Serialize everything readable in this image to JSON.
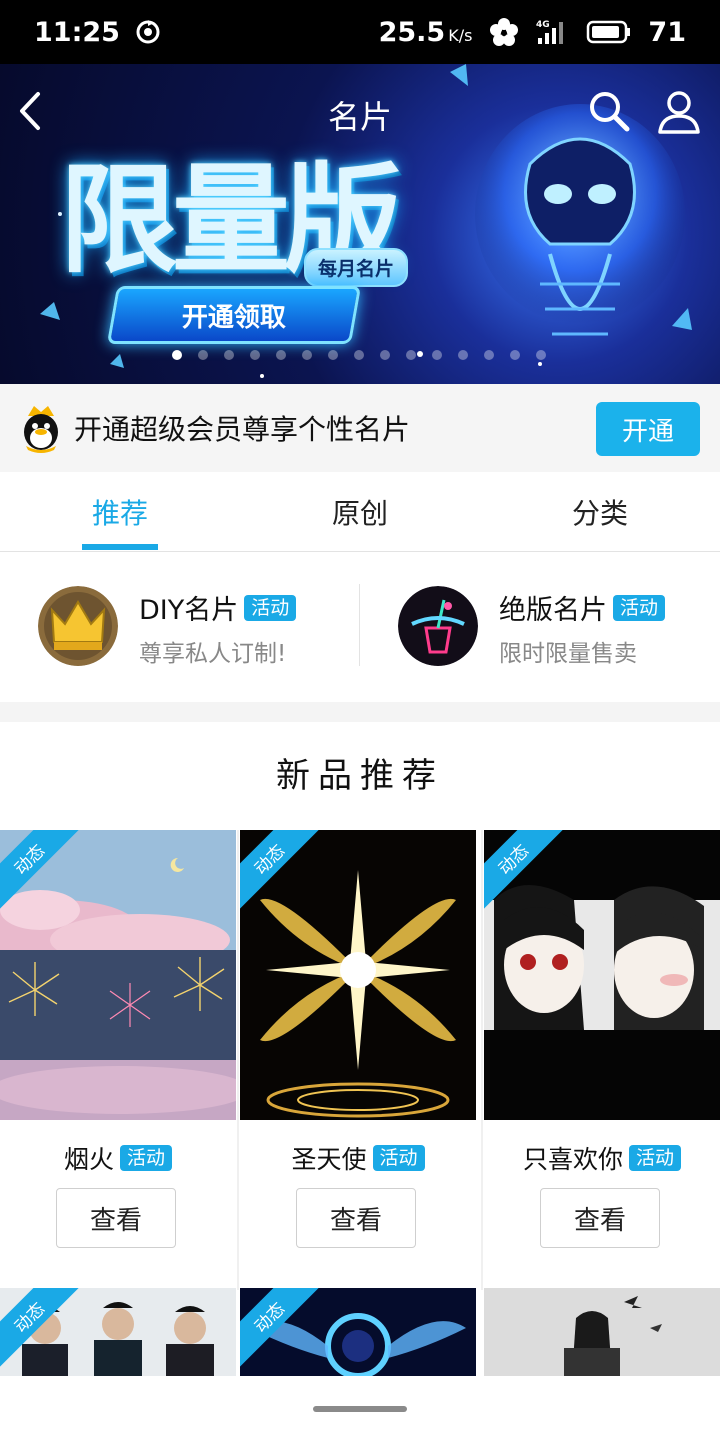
{
  "status_bar": {
    "time": "11:25",
    "net_speed": "25.5",
    "net_speed_unit": "K/s",
    "network": "4G",
    "battery": "71"
  },
  "header": {
    "title": "名片"
  },
  "banner": {
    "headline": "限量版",
    "sub": "每月名片",
    "cta": "开通领取",
    "dots_total": 15,
    "active_dot": 0
  },
  "vip": {
    "text": "开通超级会员尊享个性名片",
    "button": "开通"
  },
  "tabs": [
    {
      "label": "推荐",
      "active": true
    },
    {
      "label": "原创",
      "active": false
    },
    {
      "label": "分类",
      "active": false
    }
  ],
  "features": [
    {
      "title": "DIY名片",
      "tag": "活动",
      "desc": "尊享私人订制!"
    },
    {
      "title": "绝版名片",
      "tag": "活动",
      "desc": "限时限量售卖"
    }
  ],
  "section": {
    "title": "新品推荐"
  },
  "cards": [
    {
      "badge": "动态",
      "name": "烟火",
      "tag": "活动",
      "button": "查看"
    },
    {
      "badge": "动态",
      "name": "圣天使",
      "tag": "活动",
      "button": "查看"
    },
    {
      "badge": "动态",
      "name": "只喜欢你",
      "tag": "活动",
      "button": "查看"
    }
  ],
  "row2": [
    {
      "badge": "动态"
    },
    {
      "badge": "动态"
    },
    {
      "badge": ""
    }
  ],
  "colors": {
    "accent": "#1aa9e6",
    "vip_button": "#1bb2eb"
  }
}
